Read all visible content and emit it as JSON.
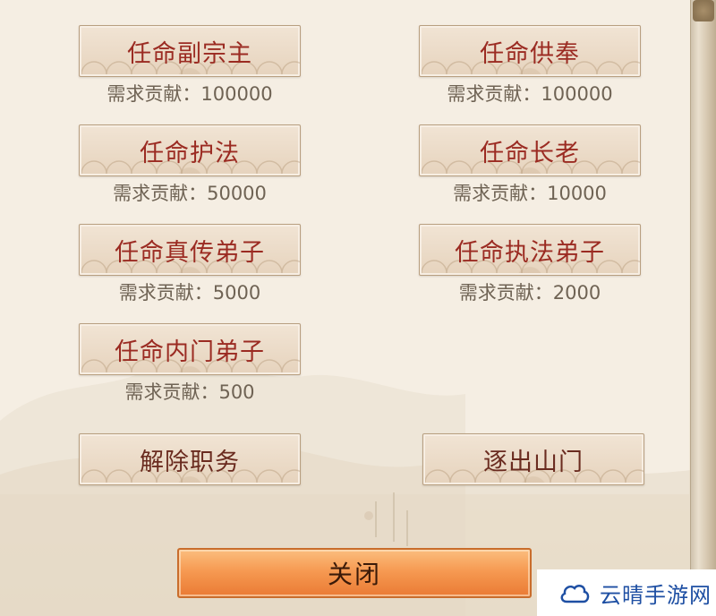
{
  "buttons": {
    "vice_master": {
      "label": "任命副宗主",
      "requirement": "需求贡献：100000"
    },
    "elder_honor": {
      "label": "任命供奉",
      "requirement": "需求贡献：100000"
    },
    "protector": {
      "label": "任命护法",
      "requirement": "需求贡献：50000"
    },
    "elder": {
      "label": "任命长老",
      "requirement": "需求贡献：10000"
    },
    "true_disciple": {
      "label": "任命真传弟子",
      "requirement": "需求贡献：5000"
    },
    "law_disciple": {
      "label": "任命执法弟子",
      "requirement": "需求贡献：2000"
    },
    "inner_disciple": {
      "label": "任命内门弟子",
      "requirement": "需求贡献：500"
    },
    "dismiss": {
      "label": "解除职务"
    },
    "expel": {
      "label": "逐出山门"
    }
  },
  "close": {
    "label": "关闭"
  },
  "watermark": {
    "text": "云晴手游网"
  },
  "colors": {
    "label_red": "#9b2b22",
    "close_orange": "#f69a52",
    "watermark_blue": "#1e4fa3"
  }
}
